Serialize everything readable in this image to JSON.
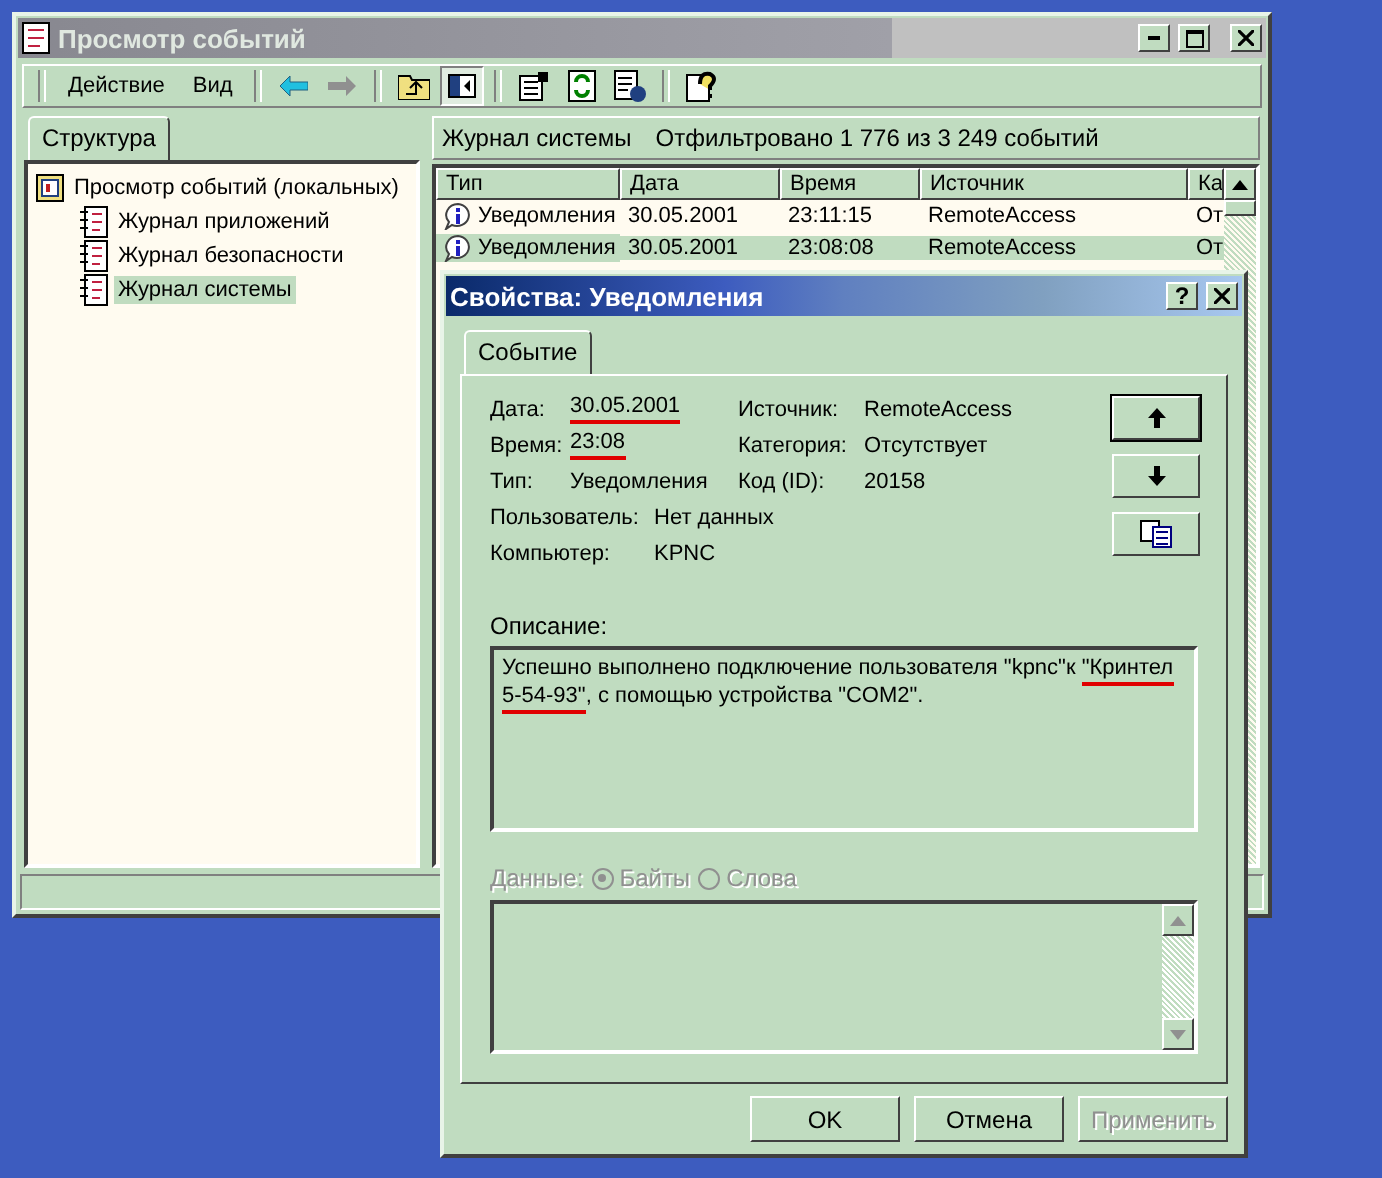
{
  "main_window": {
    "title": "Просмотр событий",
    "menu": [
      {
        "label": "Действие"
      },
      {
        "label": "Вид"
      }
    ],
    "toolbar": [
      {
        "kind": "back",
        "disabled": false
      },
      {
        "kind": "forward",
        "disabled": true
      },
      {
        "kind": "up",
        "pressed": false
      },
      {
        "kind": "tree",
        "pressed": true
      },
      {
        "kind": "properties",
        "pressed": false
      },
      {
        "kind": "refresh",
        "pressed": false
      },
      {
        "kind": "export",
        "pressed": false
      },
      {
        "kind": "help",
        "pressed": false
      }
    ],
    "tree_tab": {
      "label": "Структура",
      "selected": true
    },
    "tree": [
      {
        "label": "Просмотр событий (локальных)",
        "selected": false,
        "children": [
          {
            "label": "Журнал приложений",
            "selected": false
          },
          {
            "label": "Журнал безопасности",
            "selected": false
          },
          {
            "label": "Журнал системы",
            "selected": true
          }
        ]
      }
    ],
    "list_header": {
      "title": "Журнал системы",
      "filter": "Отфильтровано 1 776 из 3 249 событий"
    },
    "table": {
      "columns": [
        "Тип",
        "Дата",
        "Время",
        "Источник",
        "Ка"
      ],
      "rows": [
        {
          "cells": [
            "Уведомления",
            "30.05.2001",
            "23:11:15",
            "RemoteAccess",
            "От"
          ],
          "selected": false
        },
        {
          "cells": [
            "Уведомления",
            "30.05.2001",
            "23:08:08",
            "RemoteAccess",
            "От"
          ],
          "selected": true
        }
      ]
    }
  },
  "dialog": {
    "title": "Свойства: Уведомления",
    "help_button": "?",
    "tab": {
      "label": "Событие",
      "selected": true
    },
    "fields_left": [
      {
        "label": "Дата:",
        "value": "30.05.2001",
        "underlined": true
      },
      {
        "label": "Время:",
        "value": "23:08",
        "underlined": true
      },
      {
        "label": "Тип:",
        "value": "Уведомления",
        "underlined": false
      },
      {
        "label": "Пользователь:",
        "value": "Нет данных",
        "underlined": false
      },
      {
        "label": "Компьютер:",
        "value": "KPNC",
        "underlined": false
      }
    ],
    "fields_right": [
      {
        "label": "Источник:",
        "value": "RemoteAccess",
        "underlined": false
      },
      {
        "label": "Категория:",
        "value": "Отсутствует",
        "underlined": false
      },
      {
        "label": "Код (ID):",
        "value": "20158",
        "underlined": false
      }
    ],
    "description_label": "Описание:",
    "description": [
      {
        "text": "Успешно выполнено подключение пользователя \"kpnc\"к ",
        "underlined": false
      },
      {
        "text": "\"Кринтел 5-54-93\"",
        "underlined": true
      },
      {
        "text": ", с помощью устройства \"COM2\".",
        "underlined": false
      }
    ],
    "data": {
      "label": "Данные:",
      "disabled": true,
      "options": [
        {
          "label": "Байты",
          "selected": true
        },
        {
          "label": "Слова",
          "selected": false
        }
      ]
    },
    "buttons": [
      {
        "label": "OK",
        "disabled": false
      },
      {
        "label": "Отмена",
        "disabled": false
      },
      {
        "label": "Применить",
        "disabled": true
      }
    ]
  }
}
